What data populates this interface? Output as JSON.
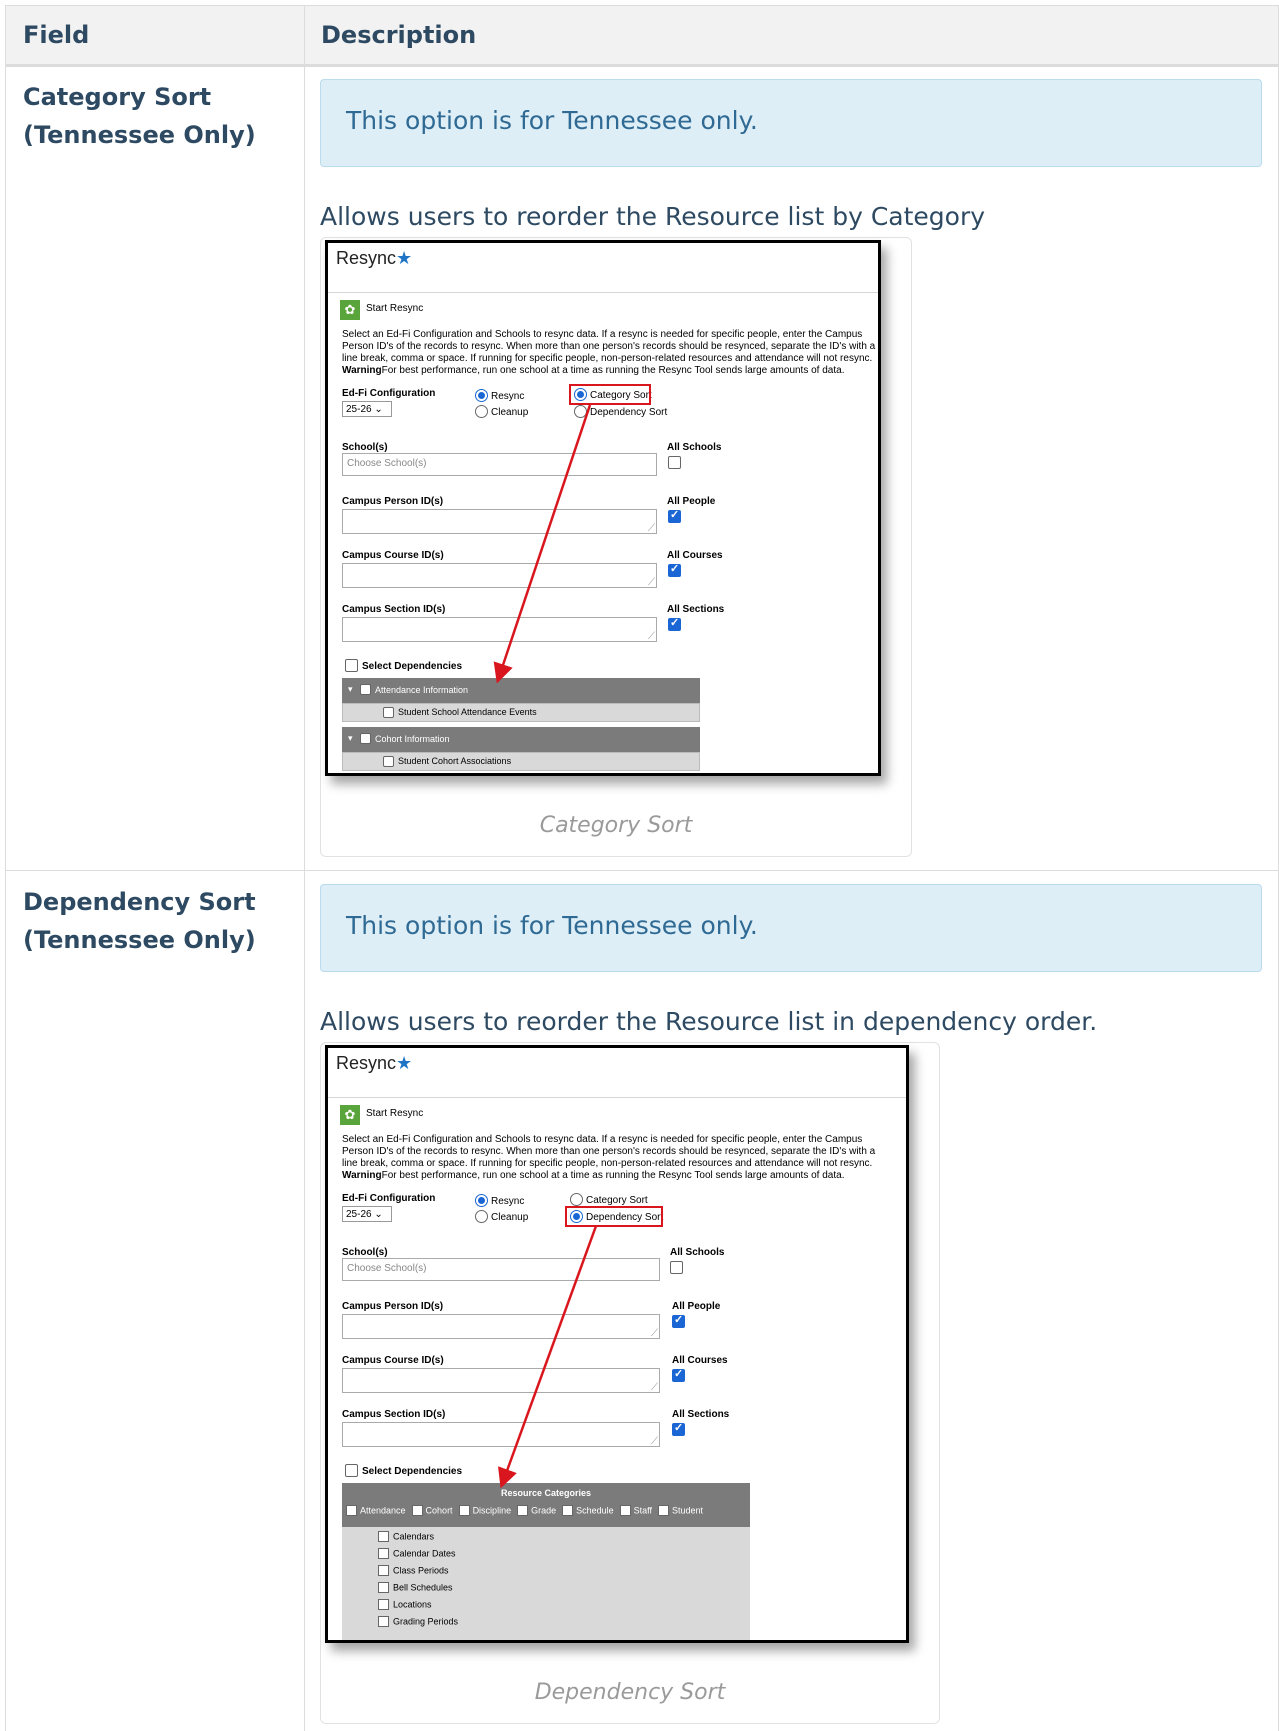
{
  "table": {
    "headers": {
      "field": "Field",
      "description": "Description"
    },
    "rows": [
      {
        "field_line1": "Category Sort",
        "field_line2": "(Tennessee Only)",
        "callout": "This option is for Tennessee only.",
        "description": "Allows users to reorder the Resource list by Category",
        "caption": "Category Sort",
        "shot": {
          "title": "Resync",
          "start": "Start Resync",
          "inst_1": "Select an Ed-Fi Configuration and Schools to resync data. If a resync is needed for specific people, enter the Campus Person ID's of the records to resync. When more than one person's records should be resynced, separate the ID's with a line break, comma or space. If running for specific people, non-person-related resources and attendance will not resync.",
          "inst_warn": "Warning",
          "inst_2": "For best performance, run one school at a time as running the Resync Tool sends large amounts of data.",
          "config_label": "Ed-Fi Configuration",
          "config_value": "25-26",
          "r_resync": "Resync",
          "r_cleanup": "Cleanup",
          "r_category": "Category Sort",
          "r_dependency": "Dependency Sort",
          "schools": "School(s)",
          "schools_placeholder": "Choose School(s)",
          "all_schools": "All Schools",
          "person": "Campus Person ID(s)",
          "all_people": "All People",
          "course": "Campus Course ID(s)",
          "all_courses": "All Courses",
          "section": "Campus Section ID(s)",
          "all_sections": "All Sections",
          "select_deps": "Select Dependencies",
          "group1": "Attendance Information",
          "group1_item": "Student School Attendance Events",
          "group2": "Cohort Information",
          "group2_item": "Student Cohort Associations"
        }
      },
      {
        "field_line1": "Dependency Sort",
        "field_line2": "(Tennessee Only)",
        "callout": "This option is for Tennessee only.",
        "description": "Allows users to reorder the Resource list in dependency order.",
        "caption": "Dependency Sort",
        "shot": {
          "title": "Resync",
          "start": "Start Resync",
          "inst_1": "Select an Ed-Fi Configuration and Schools to resync data. If a resync is needed for specific people, enter the Campus Person ID's of the records to resync. When more than one person's records should be resynced, separate the ID's with a line break, comma or space. If running for specific people, non-person-related resources and attendance will not resync.",
          "inst_warn": "Warning",
          "inst_2": "For best performance, run one school at a time as running the Resync Tool sends large amounts of data.",
          "config_label": "Ed-Fi Configuration",
          "config_value": "25-26",
          "r_resync": "Resync",
          "r_cleanup": "Cleanup",
          "r_category": "Category Sort",
          "r_dependency": "Dependency Sort",
          "schools": "School(s)",
          "schools_placeholder": "Choose School(s)",
          "all_schools": "All Schools",
          "person": "Campus Person ID(s)",
          "all_people": "All People",
          "course": "Campus Course ID(s)",
          "all_courses": "All Courses",
          "section": "Campus Section ID(s)",
          "all_sections": "All Sections",
          "select_deps": "Select Dependencies",
          "res_cat_title": "Resource Categories",
          "res_cats": [
            "Attendance",
            "Cohort",
            "Discipline",
            "Grade",
            "Schedule",
            "Staff",
            "Student"
          ],
          "res_items": [
            "Calendars",
            "Calendar Dates",
            "Class Periods",
            "Bell Schedules",
            "Locations",
            "Grading Periods"
          ]
        }
      }
    ]
  }
}
